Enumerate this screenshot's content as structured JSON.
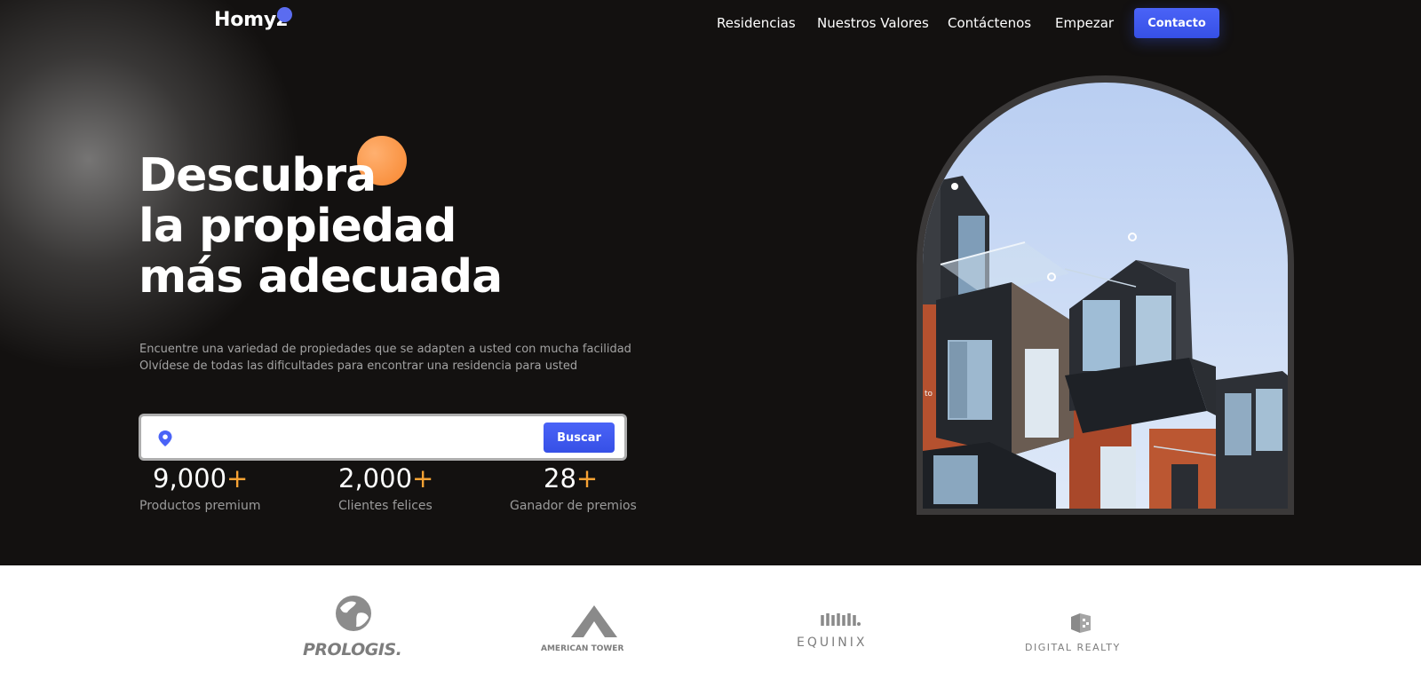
{
  "header": {
    "logo": "Homyz",
    "nav": [
      "Residencias",
      "Nuestros Valores",
      "Contáctenos",
      "Empezar"
    ],
    "contact_button": "Contacto"
  },
  "hero": {
    "title_lines": [
      "Descubra",
      "la propiedad",
      "más adecuada"
    ],
    "subtitle_lines": [
      "Encuentre una variedad de propiedades que se adapten a usted con mucha facilidad",
      "Olvídese de todas las dificultades para encontrar una residencia para usted"
    ],
    "search": {
      "value": "",
      "button_label": "Buscar",
      "icon": "location-pin-icon"
    },
    "stats": [
      {
        "number": "9,000",
        "suffix": "+",
        "label": "Productos premium"
      },
      {
        "number": "2,000",
        "suffix": "+",
        "label": "Clientes felices"
      },
      {
        "number": "28",
        "suffix": "+",
        "label": "Ganador de premios"
      }
    ],
    "image_stray_text": "to"
  },
  "brands": [
    "PROLOGIS.",
    "AMERICAN TOWER",
    "EQUINIX",
    "DIGITAL REALTY"
  ],
  "colors": {
    "hero_background": "#131110",
    "accent_blue": "#4a63f7",
    "accent_orange": "#f7a234",
    "brand_grey": "#7d7d7d"
  }
}
